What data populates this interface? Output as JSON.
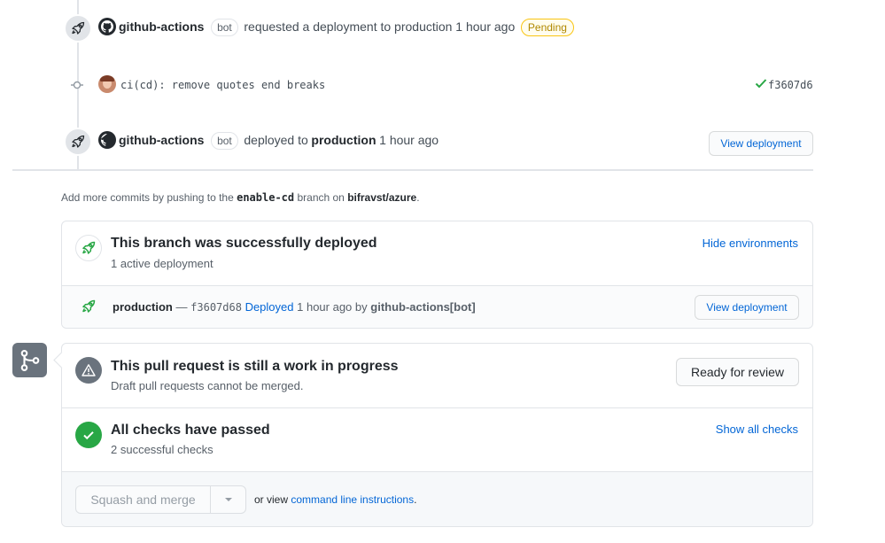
{
  "timeline": {
    "event1": {
      "actor": "github-actions",
      "badge": "bot",
      "text": "requested a deployment to production 1 hour ago",
      "status": "Pending"
    },
    "commit": {
      "message": "ci(cd): remove quotes end breaks",
      "sha": "f3607d6"
    },
    "event2": {
      "actor": "github-actions",
      "badge": "bot",
      "text_pre": "deployed to",
      "env": "production",
      "time": "1 hour ago",
      "button": "View deployment"
    }
  },
  "hint": {
    "pre": "Add more commits by pushing to the",
    "branch": "enable-cd",
    "mid": "branch on",
    "repo": "bifravst/azure",
    "post": "."
  },
  "deploy_card": {
    "title": "This branch was successfully deployed",
    "subtitle": "1 active deployment",
    "hide_link": "Hide environments",
    "row": {
      "env": "production",
      "dash": "—",
      "sha": "f3607d68",
      "status": "Deployed",
      "time": "1 hour ago by",
      "by": "github-actions[bot]",
      "button": "View deployment"
    }
  },
  "merge_box": {
    "wip_title": "This pull request is still a work in progress",
    "wip_sub": "Draft pull requests cannot be merged.",
    "ready_button": "Ready for review",
    "checks_title": "All checks have passed",
    "checks_sub": "2 successful checks",
    "show_checks": "Show all checks",
    "merge_button": "Squash and merge",
    "or_view": "or view",
    "cli_link": "command line instructions",
    "period": "."
  },
  "colors": {
    "link": "#0366d6",
    "success": "#28a745",
    "pending": "#b08800",
    "icon_gray": "#6a737d"
  }
}
